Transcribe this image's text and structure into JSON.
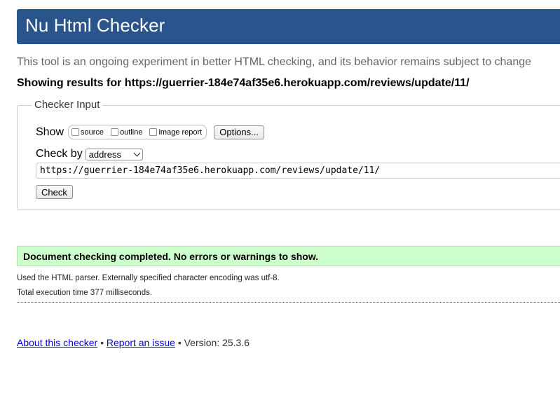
{
  "header": {
    "title": "Nu Html Checker"
  },
  "intro": "This tool is an ongoing experiment in better HTML checking, and its behavior remains subject to change",
  "results_heading": "Showing results for https://guerrier-184e74af35e6.herokuapp.com/reviews/update/11/",
  "checker_input": {
    "legend": "Checker Input",
    "show_label": "Show",
    "options": {
      "source": "source",
      "outline": "outline",
      "image_report": "image report"
    },
    "options_button": "Options...",
    "check_by_label": "Check by",
    "check_by_selected": "address",
    "url_value": "https://guerrier-184e74af35e6.herokuapp.com/reviews/update/11/",
    "check_button": "Check"
  },
  "result": {
    "message": "Document checking completed. No errors or warnings to show.",
    "parser_info": "Used the HTML parser. Externally specified character encoding was utf-8.",
    "execution_time": "Total execution time 377 milliseconds."
  },
  "footer": {
    "about_link": "About this checker",
    "separator": "•",
    "report_link": "Report an issue",
    "version": "Version: 25.3.6"
  },
  "colors": {
    "header_bg": "#2a558c",
    "success_bg": "#ccffcc",
    "link": "#0000ee"
  }
}
